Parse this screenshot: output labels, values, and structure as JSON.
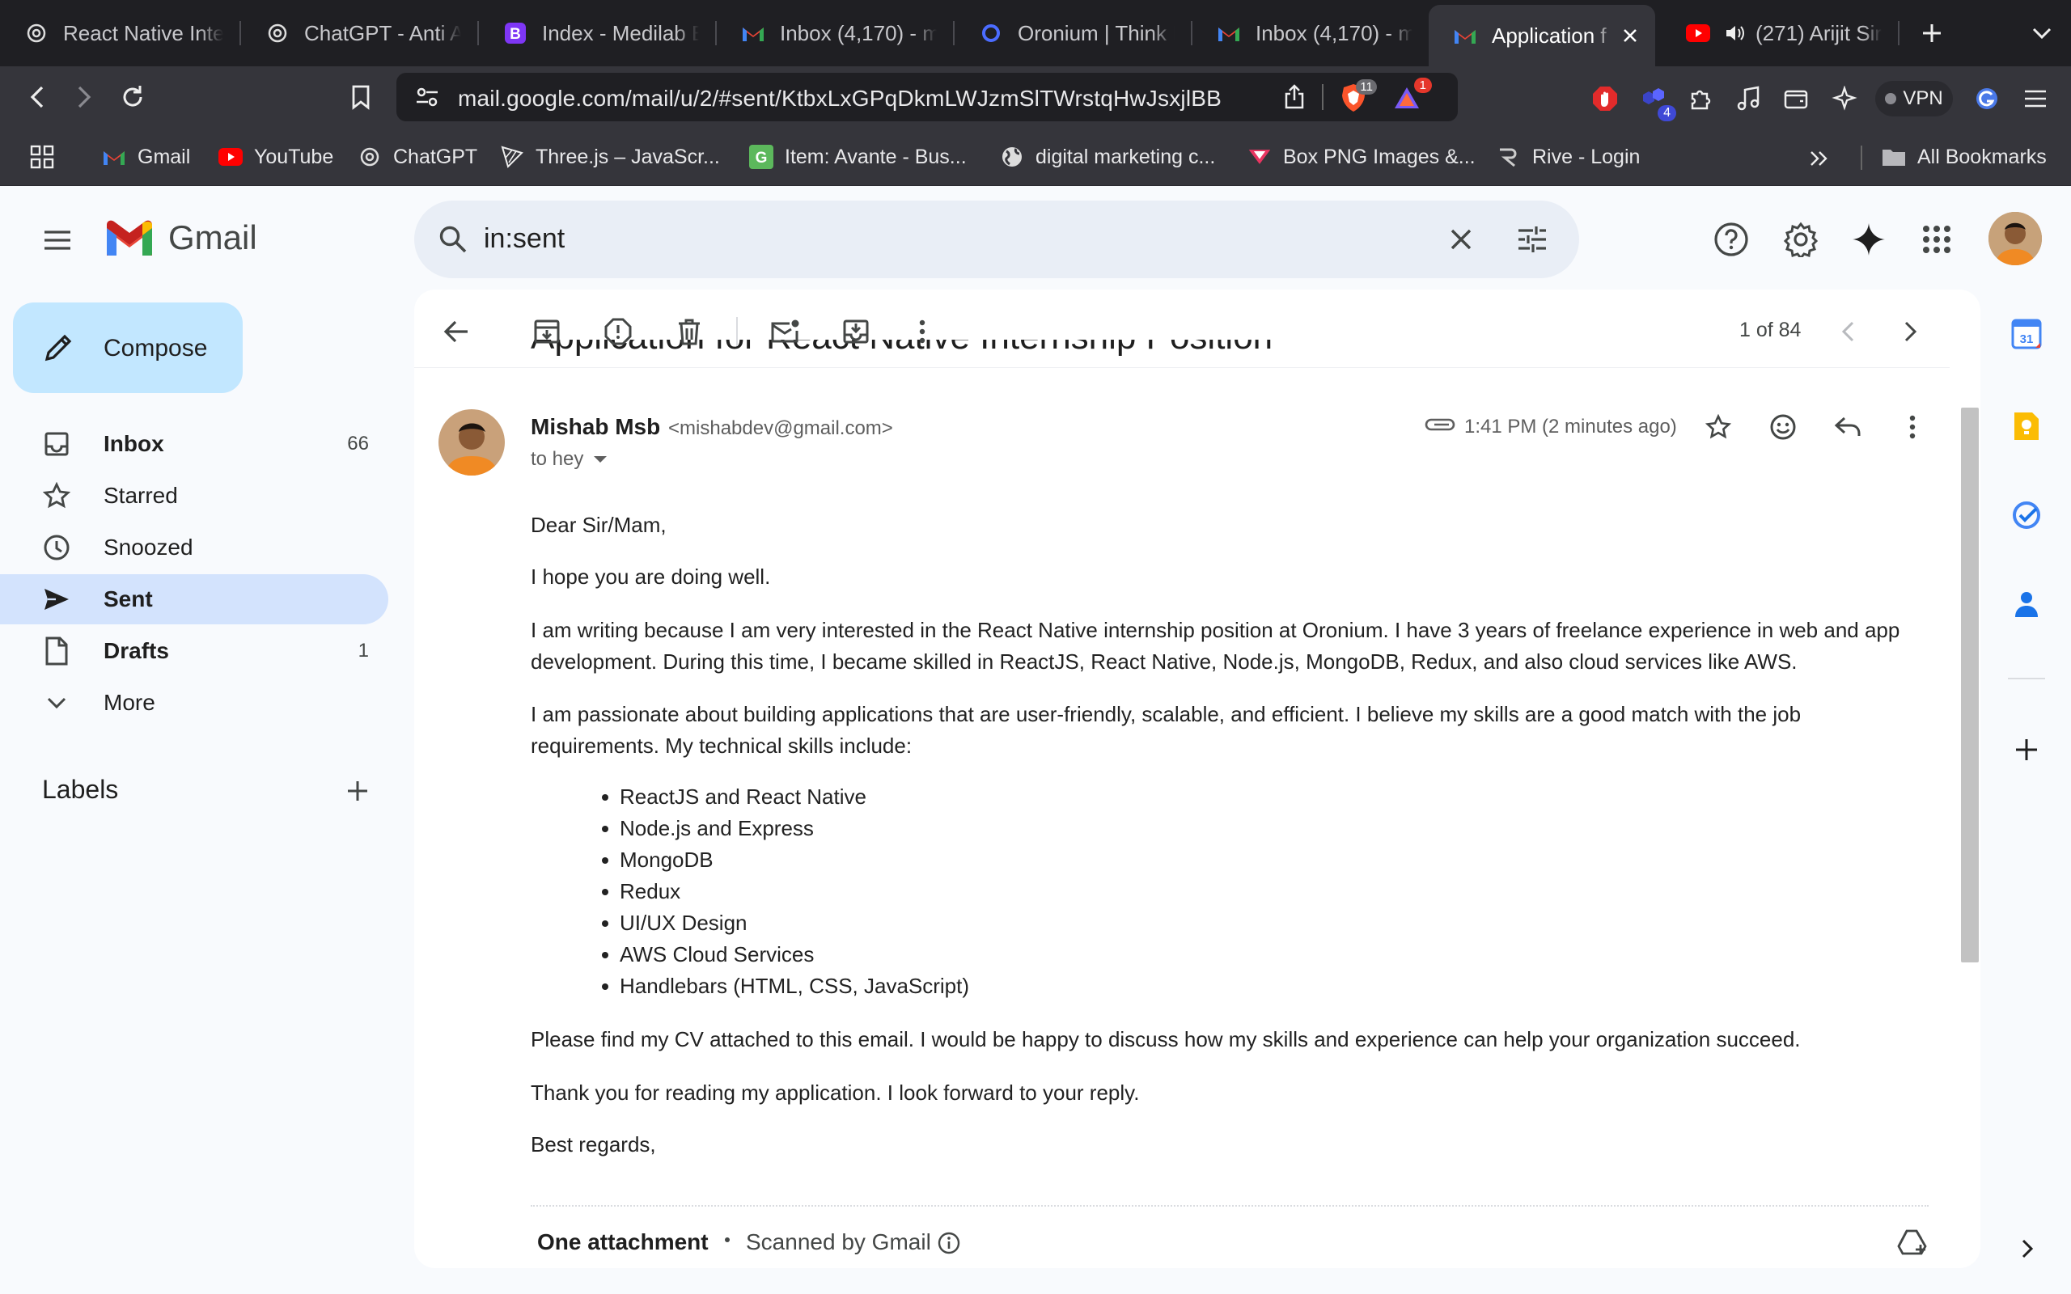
{
  "browser": {
    "tabs": [
      {
        "label": "React Native Inte",
        "icon": "chatgpt-icon"
      },
      {
        "label": "ChatGPT - Anti A",
        "icon": "chatgpt-icon"
      },
      {
        "label": "Index - Medilab B",
        "icon": "bootstrap-icon"
      },
      {
        "label": "Inbox (4,170) - m",
        "icon": "gmail-icon"
      },
      {
        "label": "Oronium | Think D",
        "icon": "oronium-icon"
      },
      {
        "label": "Inbox (4,170) - m",
        "icon": "gmail-icon"
      },
      {
        "label": "Application f",
        "icon": "gmail-icon",
        "active": true
      },
      {
        "label": "(271) Arijit Sir",
        "icon": "youtube-icon"
      }
    ],
    "url": "mail.google.com/mail/u/2/#sent/KtbxLxGPqDkmLWJzmSlTWrstqHwJsxjlBB",
    "brave_badge": "11",
    "rewards_badge": "1",
    "ext_badge": "4",
    "vpn_label": "VPN",
    "bookmarks": [
      {
        "label": "Gmail",
        "icon": "gmail-icon"
      },
      {
        "label": "YouTube",
        "icon": "youtube-icon"
      },
      {
        "label": "ChatGPT",
        "icon": "chatgpt-icon"
      },
      {
        "label": "Three.js – JavaScr...",
        "icon": "threejs-icon"
      },
      {
        "label": "Item: Avante - Bus...",
        "icon": "envato-icon"
      },
      {
        "label": "digital marketing c...",
        "icon": "globe-icon"
      },
      {
        "label": "Box PNG Images &...",
        "icon": "pngtree-icon"
      },
      {
        "label": "Rive - Login",
        "icon": "rive-icon"
      }
    ],
    "all_bookmarks_label": "All Bookmarks"
  },
  "gmail": {
    "logo_text": "Gmail",
    "search_value": "in:sent",
    "compose_label": "Compose",
    "nav": [
      {
        "label": "Inbox",
        "count": "66",
        "icon": "inbox-icon"
      },
      {
        "label": "Starred",
        "count": "",
        "icon": "star-icon"
      },
      {
        "label": "Snoozed",
        "count": "",
        "icon": "clock-icon"
      },
      {
        "label": "Sent",
        "count": "",
        "icon": "send-icon"
      },
      {
        "label": "Drafts",
        "count": "1",
        "icon": "draft-icon"
      },
      {
        "label": "More",
        "count": "",
        "icon": "chevron-down-icon"
      }
    ],
    "labels_heading": "Labels",
    "pagination": "1 of 84",
    "subject": "Application for React Native Internship Position",
    "sender_name": "Mishab Msb",
    "sender_email": "<mishabdev@gmail.com>",
    "recipient": "to hey",
    "time": "1:41 PM (2 minutes ago)",
    "body": {
      "greeting": "Dear Sir/Mam,",
      "p1": "I hope you are doing well.",
      "p2": "I am writing because I am very interested in the React Native internship position at Oronium. I have 3 years of freelance experience in web and app development. During this time, I became skilled in ReactJS, React Native, Node.js, MongoDB, Redux, and also cloud services like AWS.",
      "p3": "I am passionate about building applications that are user-friendly, scalable, and efficient. I believe my skills are a good match with the job requirements. My technical skills include:",
      "skills": [
        "ReactJS and React Native",
        "Node.js and Express",
        "MongoDB",
        "Redux",
        "UI/UX Design",
        "AWS Cloud Services",
        "Handlebars (HTML, CSS, JavaScript)"
      ],
      "p4": "Please find my CV attached to this email. I would be happy to discuss how my skills and experience can help your organization succeed.",
      "p5": "Thank you for reading my application. I look forward to your reply.",
      "closing": "Best regards,"
    },
    "attachment_heading": "One attachment",
    "scanned_label": "Scanned by Gmail"
  },
  "colors": {
    "accent_blue": "#0b57d0",
    "active_nav": "#d3e3fd",
    "compose_bg": "#c2e7ff"
  }
}
